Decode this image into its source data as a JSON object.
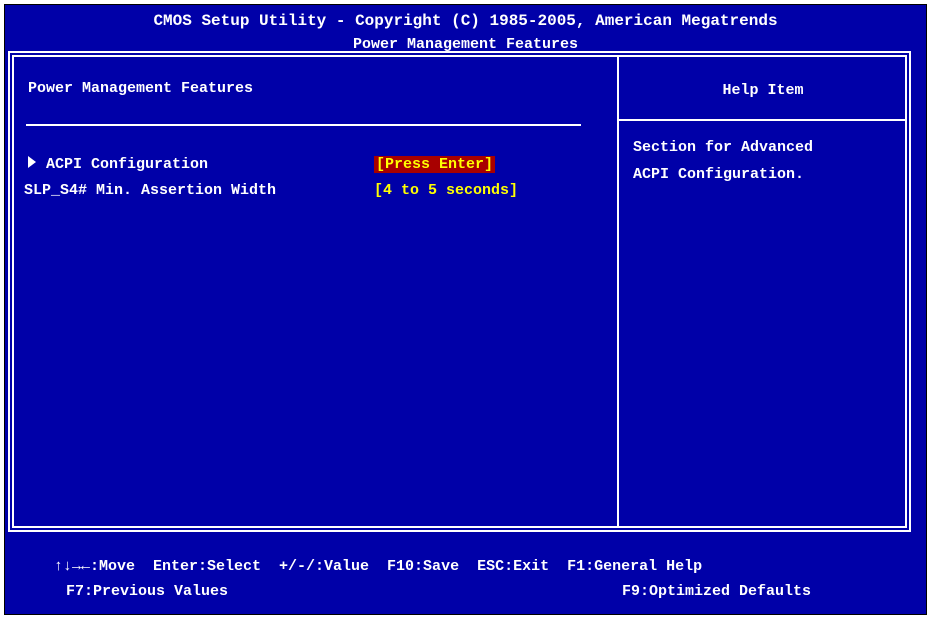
{
  "header": {
    "title": "CMOS Setup Utility - Copyright (C) 1985-2005, American Megatrends",
    "subtitle": "Power Management Features"
  },
  "main": {
    "section_title": "Power Management Features",
    "items": [
      {
        "label": "ACPI Configuration",
        "value": "[Press Enter]",
        "has_submenu": true,
        "selected": true
      },
      {
        "label": "SLP_S4# Min. Assertion Width",
        "value": "[4 to 5 seconds]",
        "has_submenu": false,
        "selected": false
      }
    ]
  },
  "help": {
    "title": "Help Item",
    "lines": [
      "Section for Advanced",
      "ACPI Configuration."
    ]
  },
  "footer": {
    "line1": "↑↓→←:Move  Enter:Select  +/-/:Value  F10:Save  ESC:Exit  F1:General Help",
    "line2_left": "F7:Previous Values",
    "line2_right": "F9:Optimized Defaults"
  },
  "colors": {
    "background": "#0000a8",
    "text": "#ffffff",
    "value": "#ffff00",
    "highlight": "#a80000"
  }
}
